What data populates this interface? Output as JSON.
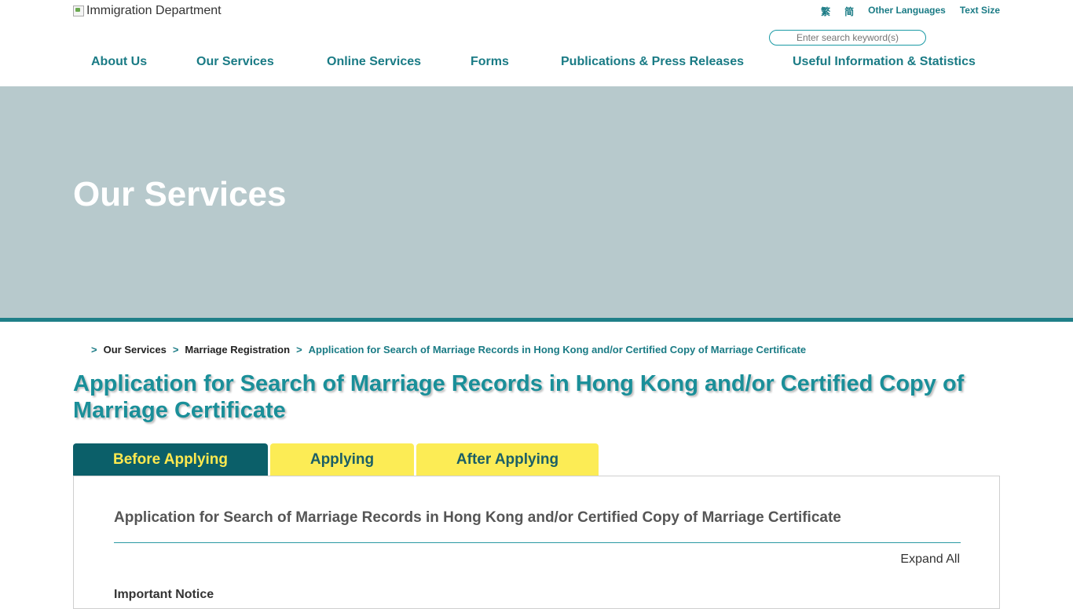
{
  "header": {
    "logo_alt": "Immigration Department",
    "links": [
      "繁",
      "简",
      "Other Languages",
      "Text Size"
    ],
    "search_placeholder": "Enter search keyword(s)"
  },
  "nav": {
    "items": [
      "About Us",
      "Our Services",
      "Online Services",
      "Forms",
      "Publications & Press Releases",
      "Useful Information & Statistics"
    ]
  },
  "banner": {
    "title": "Our Services"
  },
  "breadcrumb": {
    "separator": ">",
    "items": [
      "Our Services",
      "Marriage Registration",
      "Application for Search of Marriage Records in Hong Kong and/or Certified Copy of Marriage Certificate"
    ]
  },
  "page": {
    "title": "Application for Search of Marriage Records in Hong Kong and/or Certified Copy of Marriage Certificate"
  },
  "tabs": [
    {
      "label": "Before Applying",
      "active": true
    },
    {
      "label": "Applying",
      "active": false
    },
    {
      "label": "After Applying",
      "active": false
    }
  ],
  "panel": {
    "heading": "Application for Search of Marriage Records in Hong Kong and/or Certified Copy of Marriage Certificate",
    "expand_label": "Expand All",
    "notice_label": "Important Notice"
  },
  "colors": {
    "brand_teal": "#1a7b85",
    "banner_bg": "#b7c9cc",
    "tab_active_bg": "#0b5f69",
    "tab_inactive_bg": "#fcec55",
    "tab_active_text": "#ffe94f"
  }
}
